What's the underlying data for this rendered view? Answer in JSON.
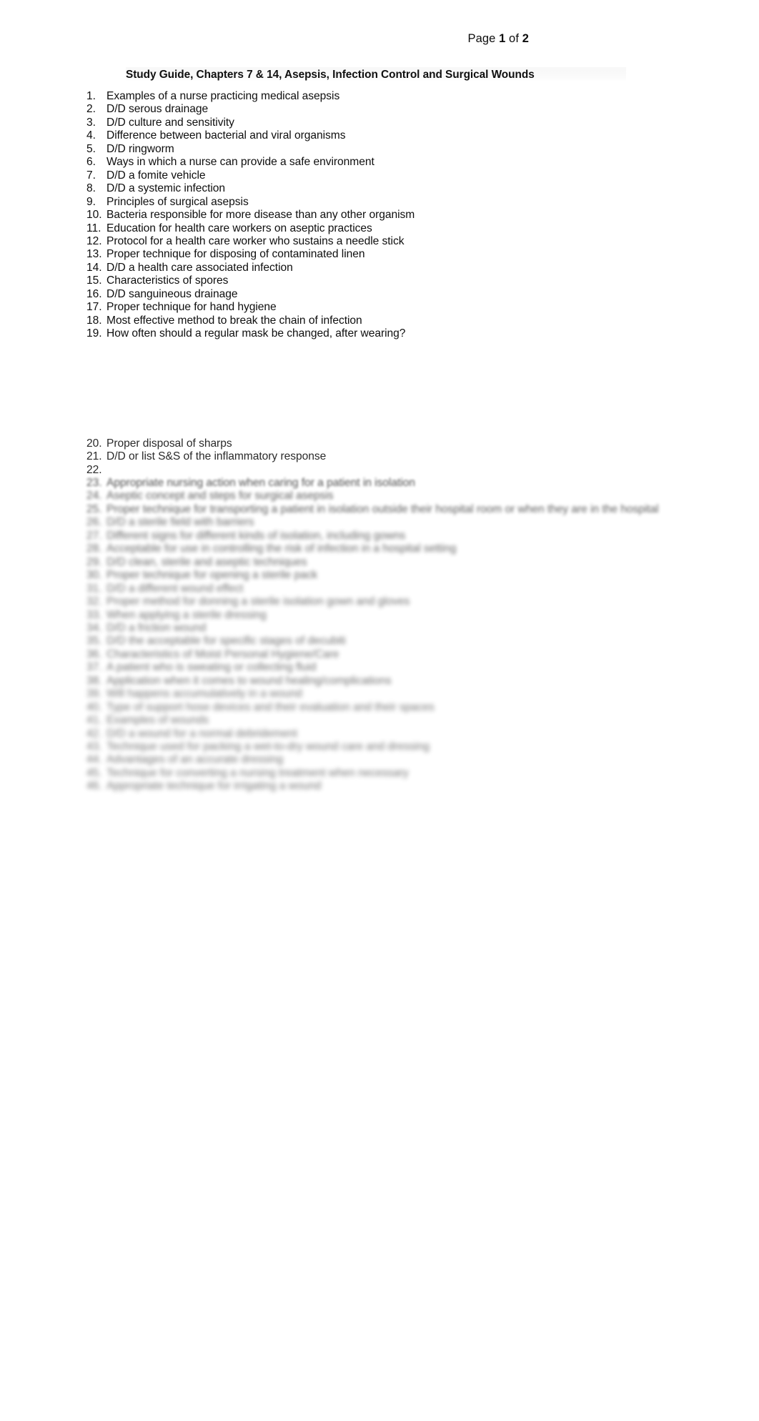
{
  "document": {
    "header": {
      "prefix": "Page ",
      "page_number": "1",
      "middle": " of ",
      "total_pages": "2",
      "full": "Page 1 of 2"
    },
    "title": "Study Guide, Chapters 7 & 14, Asepsis, Infection Control and Surgical Wounds",
    "background_color": "#ffffff",
    "text_color": "#0d0d0d"
  },
  "list": {
    "items": [
      {
        "n": "1.",
        "text": "Examples of a nurse practicing medical asepsis",
        "blur": "b0"
      },
      {
        "n": "2.",
        "text": "D/D serous drainage",
        "blur": "b0"
      },
      {
        "n": "3.",
        "text": "D/D culture and sensitivity",
        "blur": "b0"
      },
      {
        "n": "4.",
        "text": "Difference between bacterial and viral organisms",
        "blur": "b0"
      },
      {
        "n": "5.",
        "text": "D/D ringworm",
        "blur": "b0"
      },
      {
        "n": "6.",
        "text": "Ways in which a nurse can provide a safe environment",
        "blur": "b0"
      },
      {
        "n": "7.",
        "text": "D/D a fomite vehicle",
        "blur": "b0"
      },
      {
        "n": "8.",
        "text": "D/D a systemic infection",
        "blur": "b0"
      },
      {
        "n": "9.",
        "text": "Principles of surgical asepsis",
        "blur": "b0"
      },
      {
        "n": "10.",
        "text": "Bacteria responsible for more disease than any other organism",
        "blur": "b0"
      },
      {
        "n": "11.",
        "text": "Education for health care workers on aseptic practices",
        "blur": "b0"
      },
      {
        "n": "12.",
        "text": "Protocol for a health care worker who sustains a needle stick",
        "blur": "b0"
      },
      {
        "n": "13.",
        "text": "Proper technique for disposing of contaminated linen",
        "blur": "b0"
      },
      {
        "n": "14.",
        "text": "D/D a health care associated infection",
        "blur": "b0"
      },
      {
        "n": "15.",
        "text": "Characteristics of spores",
        "blur": "b0"
      },
      {
        "n": "16.",
        "text": "D/D sanguineous drainage",
        "blur": "b0"
      },
      {
        "n": "17.",
        "text": "Proper technique for hand hygiene",
        "blur": "b0"
      },
      {
        "n": "18.",
        "text": "Most effective method to break the chain of infection",
        "blur": "b0"
      },
      {
        "n": "19.",
        "text": "How often should a regular mask be changed, after wearing?",
        "blur": "b0"
      }
    ],
    "items_after_gap": [
      {
        "n": "20.",
        "text": "Proper disposal of sharps",
        "blur": "b0"
      },
      {
        "n": "21.",
        "text": "D/D or list S&S of the inflammatory response",
        "blur": "b0"
      },
      {
        "n": "22.",
        "text": "",
        "blur": "b0"
      },
      {
        "n": "23.",
        "text": "Appropriate nursing action when caring for a patient in isolation",
        "blur": "b3"
      },
      {
        "n": "24.",
        "text": "Aseptic concept and steps for surgical asepsis",
        "blur": "b4"
      },
      {
        "n": "25.",
        "text": "Proper technique for transporting a patient in isolation outside their hospital room or when they are in the hospital",
        "blur": "b4"
      },
      {
        "n": "26.",
        "text": "D/D a sterile field with barriers",
        "blur": "b5"
      },
      {
        "n": "27.",
        "text": "Different signs for different kinds of isolation, including gowns",
        "blur": "b5"
      },
      {
        "n": "28.",
        "text": "Acceptable for use in controlling the risk of infection in a hospital setting",
        "blur": "b5"
      },
      {
        "n": "29.",
        "text": "D/D clean, sterile and aseptic techniques",
        "blur": "b5"
      },
      {
        "n": "30.",
        "text": "Proper technique for opening a sterile pack",
        "blur": "b5"
      },
      {
        "n": "31.",
        "text": "D/D a different wound effect",
        "blur": "b6"
      },
      {
        "n": "32.",
        "text": "Proper method for donning a sterile isolation gown and gloves",
        "blur": "b6"
      },
      {
        "n": "33.",
        "text": "When applying a sterile dressing",
        "blur": "b6"
      },
      {
        "n": "34.",
        "text": "D/D a friction wound",
        "blur": "b6"
      },
      {
        "n": "35.",
        "text": "D/D the acceptable for specific stages of decubiti",
        "blur": "b6"
      },
      {
        "n": "36.",
        "text": "Characteristics of Moist Personal Hygiene/Care",
        "blur": "b6"
      },
      {
        "n": "37.",
        "text": "A patient who is sweating or collecting fluid",
        "blur": "b6"
      },
      {
        "n": "38.",
        "text": "Application when it comes to wound healing/complications",
        "blur": "b6"
      },
      {
        "n": "39.",
        "text": "Will happens accumulatively in a wound",
        "blur": "b7"
      },
      {
        "n": "40.",
        "text": "Type of support hose devices and their evaluation and their spaces",
        "blur": "b7"
      },
      {
        "n": "41.",
        "text": "Examples of wounds",
        "blur": "b7"
      },
      {
        "n": "42.",
        "text": "D/D a wound for a normal debridement",
        "blur": "b7"
      },
      {
        "n": "43.",
        "text": "Technique used for packing a wet-to-dry wound care and dressing",
        "blur": "b7"
      },
      {
        "n": "44.",
        "text": "Advantages of an accurate dressing",
        "blur": "b7"
      },
      {
        "n": "45.",
        "text": "Technique for converting a nursing treatment when necessary",
        "blur": "b7"
      },
      {
        "n": "46.",
        "text": "Appropriate technique for irrigating a wound",
        "blur": "b7"
      }
    ]
  }
}
